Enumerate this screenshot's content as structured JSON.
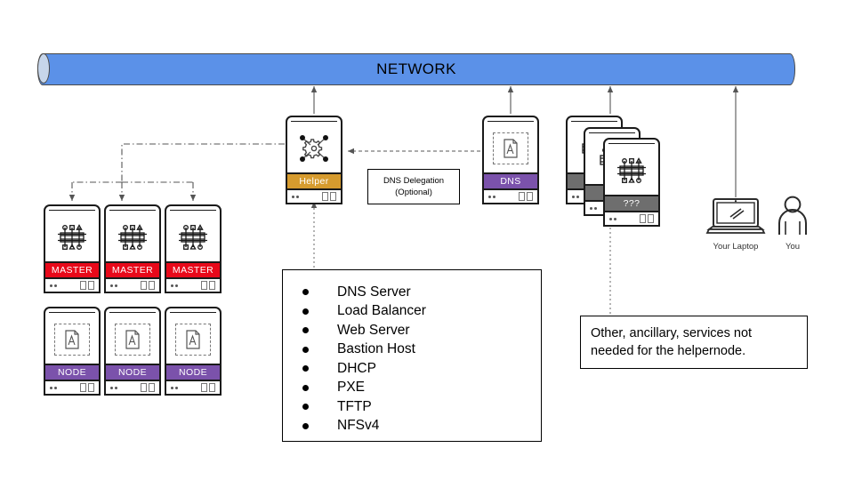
{
  "network": {
    "label": "NETWORK",
    "color": "#5b91e8"
  },
  "clusters": {
    "masters": {
      "band_color": "#e8091a",
      "icon": "chip-icon",
      "nodes": [
        {
          "label": "MASTER"
        },
        {
          "label": "MASTER"
        },
        {
          "label": "MASTER"
        }
      ]
    },
    "workers": {
      "band_color": "#7b52ab",
      "icon": "page-icon",
      "nodes": [
        {
          "label": "NODE"
        },
        {
          "label": "NODE"
        },
        {
          "label": "NODE"
        }
      ]
    }
  },
  "helper": {
    "label": "Helper",
    "band_color": "#d69b2e",
    "icon": "gear-network-icon"
  },
  "dns": {
    "label": "DNS",
    "band_color": "#7b52ab",
    "icon": "page-icon"
  },
  "unknown_stack": {
    "band_color": "#6e6e6e",
    "icon": "chip-icon",
    "nodes": [
      {
        "label": "???"
      },
      {
        "label": "???"
      },
      {
        "label": "???"
      }
    ]
  },
  "dns_delegation": {
    "line1": "DNS Delegation",
    "line2": "(Optional)"
  },
  "services": {
    "items": [
      "DNS Server",
      "Load Balancer",
      "Web Server",
      "Bastion Host",
      "DHCP",
      "PXE",
      "TFTP",
      "NFSv4"
    ]
  },
  "ancillary_note": {
    "text": "Other, ancillary, services not needed for the helpernode."
  },
  "client": {
    "laptop_label": "Your Laptop",
    "person_label": "You",
    "laptop_icon": "laptop-icon",
    "person_icon": "person-icon"
  }
}
